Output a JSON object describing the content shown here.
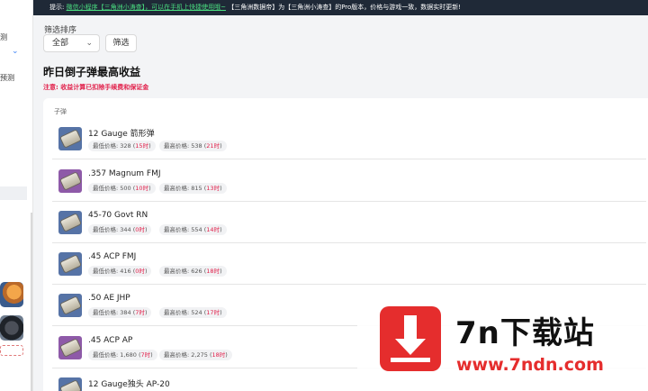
{
  "sidebar": {
    "items": [
      "测",
      "",
      "预测",
      "",
      ""
    ]
  },
  "notice": {
    "prefix": "提示:",
    "link1": "微信小程序【三角洲小涛查】，可以在手机上快捷使用哦~",
    "suffix": "【三角洲数据帝】为【三角洲小涛查】的Pro版本，价格与游戏一致，数据实时更新!"
  },
  "filter": {
    "title": "筛选排序",
    "selected": "全部",
    "button": "筛选"
  },
  "page_title": "昨日倒子弹最高收益",
  "note": "注意: 收益计算已扣除手续费和保证金",
  "table": {
    "header": "子弹",
    "low_label": "最低价格",
    "high_label": "最高价格",
    "rows": [
      {
        "name": "12 Gauge 箭形弹",
        "color": "blue",
        "low": "328",
        "low_time": "15时",
        "high": "538",
        "high_time": "21时"
      },
      {
        "name": ".357 Magnum FMJ",
        "color": "purple",
        "low": "500",
        "low_time": "10时",
        "high": "815",
        "high_time": "13时"
      },
      {
        "name": "45-70 Govt RN",
        "color": "blue",
        "low": "344",
        "low_time": "0时",
        "high": "554",
        "high_time": "14时"
      },
      {
        "name": ".45 ACP FMJ",
        "color": "blue",
        "low": "416",
        "low_time": "0时",
        "high": "626",
        "high_time": "18时"
      },
      {
        "name": ".50 AE JHP",
        "color": "blue",
        "low": "384",
        "low_time": "7时",
        "high": "524",
        "high_time": "17时"
      },
      {
        "name": ".45 ACP AP",
        "color": "purple",
        "low": "1,680",
        "low_time": "7时",
        "high": "2,275",
        "high_time": "18时"
      },
      {
        "name": "12 Gauge独头 AP-20",
        "color": "blue",
        "low": "",
        "low_time": "",
        "high": "",
        "high_time": ""
      }
    ]
  },
  "watermark": {
    "brand": "7n下载站",
    "url": "www.7ndn.com"
  }
}
